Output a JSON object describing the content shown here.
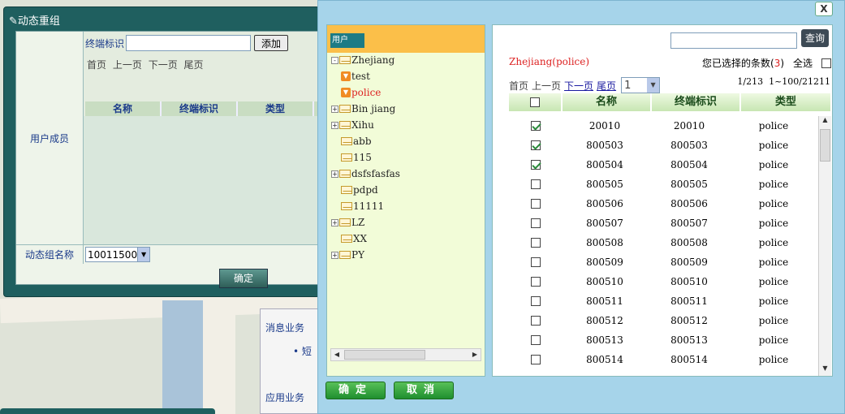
{
  "left_dialog": {
    "title": "✎动态重组",
    "terminal_label": "终端标识",
    "terminal_value": "",
    "add_button": "添加",
    "pager": {
      "first": "首页",
      "prev": "上一页",
      "next": "下一页",
      "last": "尾页"
    },
    "columns": [
      "名称",
      "终端标识",
      "类型"
    ],
    "members_label": "用户成员",
    "group_name_label": "动态组名称",
    "group_name_value": "10011500",
    "ok_button": "确定"
  },
  "right_dialog": {
    "close_label": "X",
    "tree_header": "用户",
    "tree": [
      {
        "label": "Zhejiang",
        "type": "folder",
        "expander": "-",
        "level": 0
      },
      {
        "label": "test",
        "type": "leaf",
        "level": 1
      },
      {
        "label": "police",
        "type": "leaf",
        "level": 1,
        "selected": true
      },
      {
        "label": "Bin jiang",
        "type": "folder",
        "expander": "+",
        "level": 1
      },
      {
        "label": "Xihu",
        "type": "folder",
        "expander": "+",
        "level": 1
      },
      {
        "label": "abb",
        "type": "folder",
        "level": 1
      },
      {
        "label": "115",
        "type": "folder",
        "level": 1
      },
      {
        "label": "dsfsfasfas",
        "type": "folder",
        "expander": "+",
        "level": 1
      },
      {
        "label": "pdpd",
        "type": "folder",
        "level": 1
      },
      {
        "label": "11111",
        "type": "folder",
        "level": 1
      },
      {
        "label": "LZ",
        "type": "folder",
        "expander": "+",
        "level": 1
      },
      {
        "label": "XX",
        "type": "folder",
        "level": 1
      },
      {
        "label": "PY",
        "type": "folder",
        "expander": "+",
        "level": 1
      }
    ],
    "search": {
      "value": "",
      "button": "查询"
    },
    "current_path": "Zhejiang(police)",
    "selected_count_label": "您已选择的条数(",
    "selected_count": "3",
    "selected_count_close": ")",
    "select_all_label": "全选",
    "pager": {
      "first": "首页",
      "prev": "上一页",
      "next": "下一页",
      "last": "尾页",
      "page": "1",
      "page_info": "1/213",
      "range_info": "1~100/21211"
    },
    "columns": [
      "名称",
      "终端标识",
      "类型"
    ],
    "rows": [
      {
        "name": "20010",
        "terminal": "20010",
        "type": "police",
        "checked": true
      },
      {
        "name": "800503",
        "terminal": "800503",
        "type": "police",
        "checked": true
      },
      {
        "name": "800504",
        "terminal": "800504",
        "type": "police",
        "checked": true
      },
      {
        "name": "800505",
        "terminal": "800505",
        "type": "police",
        "checked": false
      },
      {
        "name": "800506",
        "terminal": "800506",
        "type": "police",
        "checked": false
      },
      {
        "name": "800507",
        "terminal": "800507",
        "type": "police",
        "checked": false
      },
      {
        "name": "800508",
        "terminal": "800508",
        "type": "police",
        "checked": false
      },
      {
        "name": "800509",
        "terminal": "800509",
        "type": "police",
        "checked": false
      },
      {
        "name": "800510",
        "terminal": "800510",
        "type": "police",
        "checked": false
      },
      {
        "name": "800511",
        "terminal": "800511",
        "type": "police",
        "checked": false
      },
      {
        "name": "800512",
        "terminal": "800512",
        "type": "police",
        "checked": false
      },
      {
        "name": "800513",
        "terminal": "800513",
        "type": "police",
        "checked": false
      },
      {
        "name": "800514",
        "terminal": "800514",
        "type": "police",
        "checked": false
      }
    ],
    "ok_button": "确定",
    "cancel_button": "取消"
  },
  "background": {
    "msg_service": "消息业务",
    "app_service": "应用业务"
  }
}
